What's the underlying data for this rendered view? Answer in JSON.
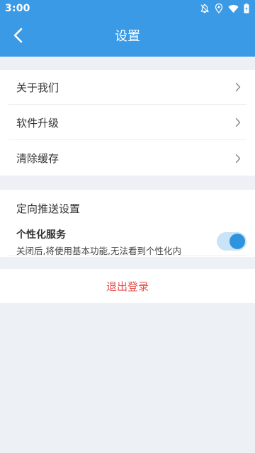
{
  "status_bar": {
    "time": "3:00",
    "icons": [
      "notifications-off-icon",
      "location-icon",
      "wifi-icon",
      "battery-charging-icon"
    ]
  },
  "header": {
    "title": "设置",
    "back_icon": "chevron-left-icon"
  },
  "menu": {
    "items": [
      {
        "label": "关于我们"
      },
      {
        "label": "软件升级"
      },
      {
        "label": "清除缓存"
      }
    ]
  },
  "push_settings": {
    "section_title": "定向推送设置",
    "service_title": "个性化服务",
    "description": "关闭后,将使用基本功能,无法看到个性化内",
    "toggle_on": true
  },
  "logout": {
    "label": "退出登录"
  },
  "colors": {
    "primary": "#3a9ae6",
    "background": "#edf1f5",
    "logout_text": "#e45050",
    "toggle_track": "#c9e3f7",
    "toggle_knob": "#2e94e0"
  }
}
